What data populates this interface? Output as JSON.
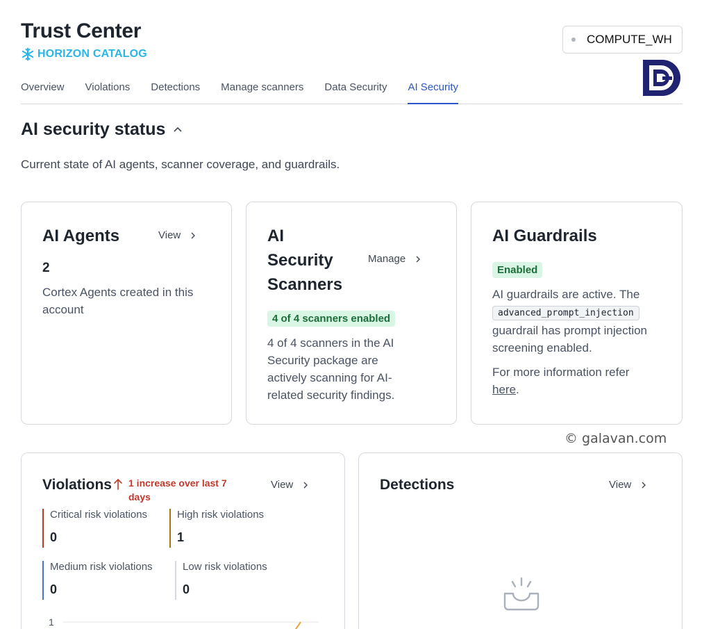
{
  "header": {
    "title": "Trust Center",
    "brand": "HORIZON CATALOG",
    "warehouse": "COMPUTE_WH"
  },
  "tabs": [
    {
      "label": "Overview"
    },
    {
      "label": "Violations"
    },
    {
      "label": "Detections"
    },
    {
      "label": "Manage scanners"
    },
    {
      "label": "Data Security"
    },
    {
      "label": "AI Security",
      "active": true
    }
  ],
  "section": {
    "title": "AI security status",
    "description": "Current state of AI agents, scanner coverage, and guardrails."
  },
  "agents_card": {
    "title": "AI Agents",
    "link": "View",
    "count": "2",
    "description": "Cortex Agents created in this account"
  },
  "scanners_card": {
    "title_line1": "AI",
    "title_line2": "Security",
    "title_line3": "Scanners",
    "link": "Manage",
    "badge": "4 of 4 scanners enabled",
    "description": "4 of 4 scanners in the AI Security package are actively scanning for AI-related security findings."
  },
  "guardrails_card": {
    "title": "AI Guardrails",
    "badge": "Enabled",
    "text_before": "AI guardrails are active. The",
    "code": "advanced_prompt_injection",
    "text_after": "guardrail has prompt injection screening enabled.",
    "more_info": "For more information refer",
    "more_link": "here",
    "more_end": "."
  },
  "watermark": "© galavan.com",
  "violations_card": {
    "title": "Violations",
    "trend": "1 increase over last 7 days",
    "link": "View",
    "stats": [
      {
        "label": "Critical risk violations",
        "value": "0",
        "color": "#c0392b"
      },
      {
        "label": "High risk violations",
        "value": "1",
        "color": "#9a7d0a"
      },
      {
        "label": "Medium risk violations",
        "value": "0",
        "color": "#4a72d9"
      },
      {
        "label": "Low risk violations",
        "value": "0",
        "color": "#d5d9df"
      }
    ],
    "chart_tick": "1"
  },
  "detections_card": {
    "title": "Detections",
    "link": "View"
  },
  "colors": {
    "accent": "#2a56c6",
    "brand": "#29b5e8",
    "success_bg": "#d9f5e3",
    "success_text": "#1b6e3a",
    "trend": "#c0392b"
  }
}
